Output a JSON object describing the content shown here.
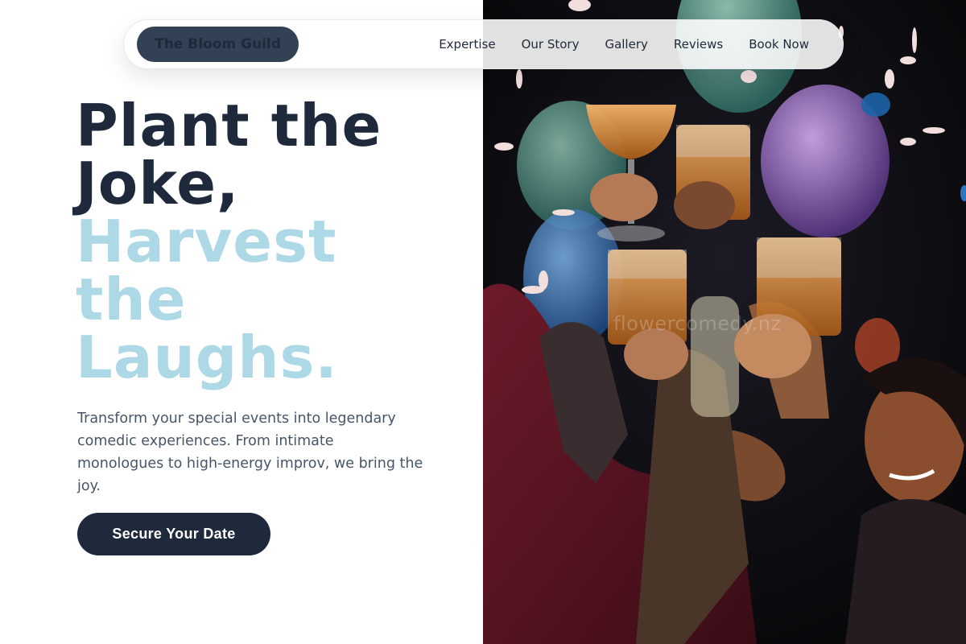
{
  "nav": {
    "brand": "The Bloom Guild",
    "links": [
      {
        "label": "Expertise"
      },
      {
        "label": "Our Story"
      },
      {
        "label": "Gallery"
      },
      {
        "label": "Reviews"
      },
      {
        "label": "Book Now"
      }
    ]
  },
  "hero": {
    "headline_part1": "Plant the Joke,",
    "headline_part2": "Harvest the Laughs.",
    "description": "Transform your special events into legendary comedic experiences. From intimate monologues to high-energy improv, we bring the joy.",
    "cta_label": "Secure Your Date",
    "image_watermark": "flowercomedy.nz"
  },
  "colors": {
    "dark_text": "#1e293b",
    "accent_light_blue": "#add8e6",
    "body_text": "#475569",
    "brand_pill": "#334155"
  }
}
